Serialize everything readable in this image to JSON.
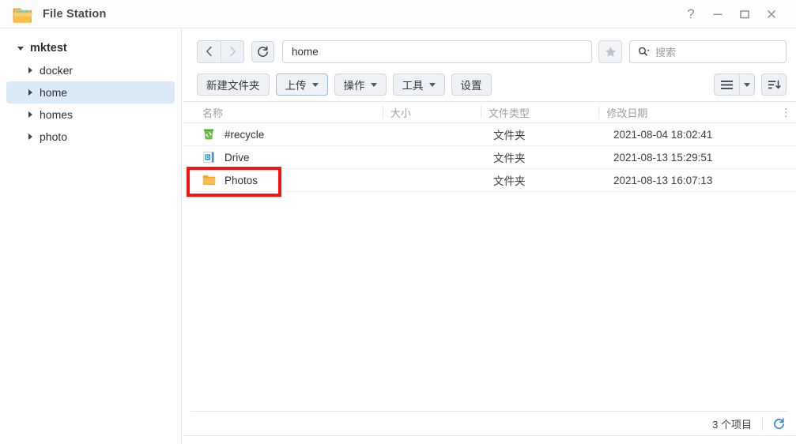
{
  "window": {
    "title": "File Station",
    "logo_icon": "folder-icon",
    "controls": [
      {
        "name": "help-button",
        "icon": "question-mark-icon",
        "label": "?"
      },
      {
        "name": "minimize-button",
        "icon": "minimize-icon",
        "label": "—"
      },
      {
        "name": "maximize-button",
        "icon": "maximize-icon",
        "label": "□"
      },
      {
        "name": "close-button",
        "icon": "close-icon",
        "label": "✕"
      }
    ]
  },
  "sidebar": {
    "root": {
      "label": "mktest",
      "expanded": true,
      "caret": "caret-down-icon"
    },
    "items": [
      {
        "label": "docker",
        "selected": false,
        "caret": "caret-right-icon"
      },
      {
        "label": "home",
        "selected": true,
        "caret": "caret-right-icon"
      },
      {
        "label": "homes",
        "selected": false,
        "caret": "caret-right-icon"
      },
      {
        "label": "photo",
        "selected": false,
        "caret": "caret-right-icon"
      }
    ],
    "selected_color": "#dce9f7"
  },
  "navbar": {
    "back_icon": "chevron-left-icon",
    "forward_icon": "chevron-right-icon",
    "refresh_icon": "refresh-icon",
    "path_value": "home",
    "star_icon": "star-icon",
    "search_icon": "search-icon",
    "search_placeholder": "搜索"
  },
  "toolbar": {
    "buttons": [
      {
        "label": "新建文件夹",
        "has_caret": false,
        "active": false
      },
      {
        "label": "上传",
        "has_caret": true,
        "active": true
      },
      {
        "label": "操作",
        "has_caret": true,
        "active": false
      },
      {
        "label": "工具",
        "has_caret": true,
        "active": false
      },
      {
        "label": "设置",
        "has_caret": false,
        "active": false
      }
    ],
    "view_icon": "list-view-icon",
    "view_caret_icon": "chevron-down-icon",
    "sort_icon": "sort-descending-icon"
  },
  "table": {
    "columns": [
      {
        "key": "name",
        "label": "名称"
      },
      {
        "key": "size",
        "label": "大小"
      },
      {
        "key": "type",
        "label": "文件类型"
      },
      {
        "key": "date",
        "label": "修改日期"
      }
    ],
    "menu_icon": "column-options-icon",
    "rows": [
      {
        "icon": "recycle-bin-icon",
        "name": "#recycle",
        "size": "",
        "type": "文件夹",
        "date": "2021-08-04 18:02:41"
      },
      {
        "icon": "drive-document-icon",
        "name": "Drive",
        "size": "",
        "type": "文件夹",
        "date": "2021-08-13 15:29:51"
      },
      {
        "icon": "folder-icon",
        "name": "Photos",
        "size": "",
        "type": "文件夹",
        "date": "2021-08-13 16:07:13"
      }
    ]
  },
  "footer": {
    "count_label": "3 个项目",
    "refresh_icon": "refresh-icon",
    "refresh_color": "#2f7fd1"
  },
  "annotation": {
    "target": "Photos",
    "color": "#fb1010"
  }
}
